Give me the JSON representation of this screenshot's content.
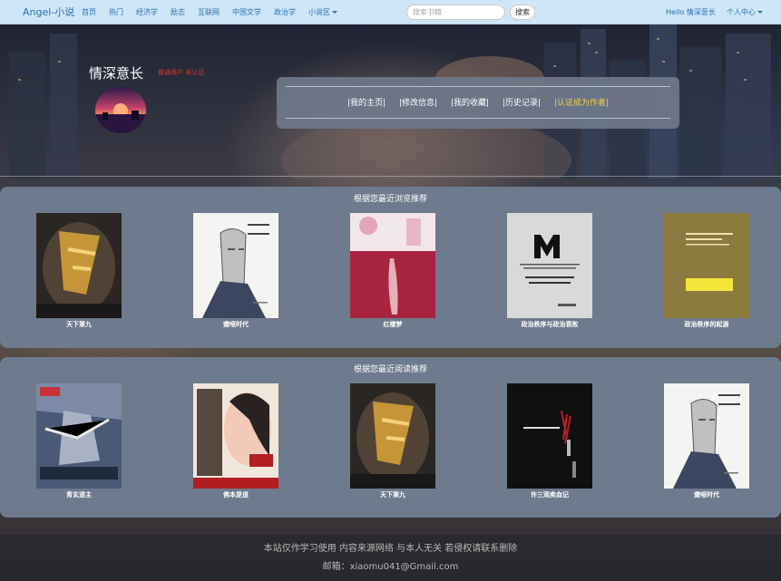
{
  "navbar": {
    "brand": "Angel-小说",
    "links": [
      "首页",
      "热门",
      "经济学",
      "励志",
      "互联网",
      "中国文学",
      "政治学"
    ],
    "dropdown": "小说区",
    "search_placeholder": "搜索书籍",
    "search_button": "搜索",
    "greeting": "Hello 情深意长",
    "user_menu": "个人中心"
  },
  "profile": {
    "username": "情深意长",
    "level": "普通用户 未认证",
    "menu": [
      "|我的主页|",
      "|修改信息|",
      "|我的收藏|",
      "|历史记录|",
      "|认证成为作者|"
    ]
  },
  "sections": [
    {
      "title": "根据您最近浏览推荐",
      "books": [
        "天下第九",
        "聋哑时代",
        "红楼梦",
        "政治秩序与政治衰败",
        "政治秩序的起源"
      ]
    },
    {
      "title": "根据您最近阅读推荐",
      "books": [
        "青玄道主",
        "佛本是道",
        "天下第九",
        "许三观卖血记",
        "聋哑时代"
      ]
    }
  ],
  "footer": {
    "line1": "本站仅作学习使用 内容来源网络 与本人无关 若侵权请联系删除",
    "line2": "邮箱：xiaomu041@Gmail.com"
  },
  "colors": {
    "navbar": "#cfe6f7",
    "link": "#2a6fb0",
    "panel": "#6e7a8d",
    "accent_gold": "#f2d04a",
    "level_red": "#e0332b"
  }
}
